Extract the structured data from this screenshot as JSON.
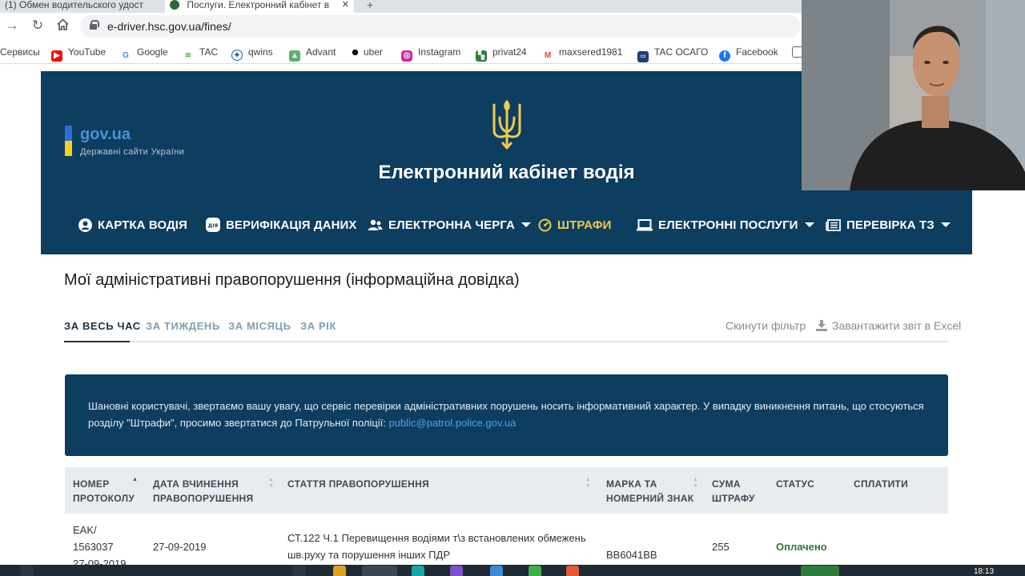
{
  "browser": {
    "tabs": [
      {
        "title": "(1) Обмен водительского удост"
      },
      {
        "title": "Послуги. Електронний кабінет в"
      }
    ],
    "url": "e-driver.hsc.gov.ua/fines/",
    "bookmarks": [
      {
        "label": "Сервисы",
        "icon": "apps-icon"
      },
      {
        "label": "YouTube",
        "icon": "youtube-icon",
        "color": "#ff0000"
      },
      {
        "label": "Google",
        "icon": "google-icon",
        "color": "#4285f4"
      },
      {
        "label": "TAC",
        "icon": "wifi-icon",
        "color": "#5cb85c"
      },
      {
        "label": "qwins",
        "icon": "qwins-icon",
        "color": "#1e5aa8"
      },
      {
        "label": "Advant",
        "icon": "advant-icon",
        "color": "#5bb36b"
      },
      {
        "label": "uber",
        "icon": "uber-icon",
        "color": "#000000"
      },
      {
        "label": "Instagram",
        "icon": "instagram-icon",
        "color": "#d6249f"
      },
      {
        "label": "privat24",
        "icon": "privat24-icon",
        "color": "#2e7d32"
      },
      {
        "label": "maxsered1981",
        "icon": "gmail-icon",
        "color": "#ea4335"
      },
      {
        "label": "TAC ОСАГО",
        "icon": "tac-osago-icon",
        "color": "#1e3d73"
      },
      {
        "label": "Facebook",
        "icon": "facebook-icon",
        "color": "#1877f2"
      }
    ]
  },
  "site": {
    "gov_name": "gov.ua",
    "gov_sub": "Державні сайти України",
    "title": "Електронний кабінет водія",
    "nav": [
      {
        "label": "КАРТКА ВОДІЯ",
        "icon": "user-circle-icon"
      },
      {
        "label": "ВЕРИФІКАЦІЯ ДАНИХ",
        "icon": "diia-icon"
      },
      {
        "label": "ЕЛЕКТРОННА ЧЕРГА",
        "icon": "people-icon"
      },
      {
        "label": "ШТРАФИ",
        "icon": "speedometer-icon"
      },
      {
        "label": "ЕЛЕКТРОННІ ПОСЛУГИ",
        "icon": "laptop-icon"
      },
      {
        "label": "ПЕРЕВІРКА ТЗ",
        "icon": "newspaper-icon"
      }
    ],
    "active_color": "#f2c94c"
  },
  "page": {
    "title": "Мої адміністративні правопорушення (інформаційна довідка)",
    "filters": [
      "ЗА ВЕСЬ ЧАС",
      "ЗА ТИЖДЕНЬ",
      "ЗА МІСЯЦЬ",
      "ЗА РІК"
    ],
    "reset_filter": "Скинути фільтр",
    "download_excel": "Завантажити звіт в Excel",
    "notice_text": "Шановні користувачі, звертаємо вашу увагу, що сервіс перевірки адміністративних порушень носить інформативний характер. У випадку виникнення питань, що стосуються розділу \"Штрафи\", просимо звертатися до Патрульної поліції: ",
    "notice_link": "public@patrol.police.gov.ua"
  },
  "table": {
    "headers": {
      "protocol": [
        "НОМЕР",
        "ПРОТОКОЛУ"
      ],
      "date": [
        "ДАТА ВЧИНЕННЯ",
        "ПРАВОПОРУШЕННЯ"
      ],
      "article": [
        "СТАТТЯ ПРАВОПОРУШЕННЯ"
      ],
      "vehicle": [
        "МАРКА ТА",
        "НОМЕРНИЙ ЗНАК"
      ],
      "amount": [
        "СУМА",
        "ШТРАФУ"
      ],
      "status": [
        "СТАТУС"
      ],
      "pay": [
        "СПЛАТИТИ"
      ]
    },
    "rows": [
      {
        "protocol": [
          "EAK/",
          "1563037",
          "27-09-2019"
        ],
        "date": "27-09-2019",
        "article": [
          "СТ.122 Ч.1 Перевищення водіями т\\з встановлених обмежень",
          "шв.руху та порушення інших ПДР"
        ],
        "vehicle": "BB6041BB",
        "amount": "255",
        "status": "Оплачено",
        "status_color": "#2e7d32"
      }
    ]
  },
  "taskbar": {
    "clock": "18:13"
  }
}
